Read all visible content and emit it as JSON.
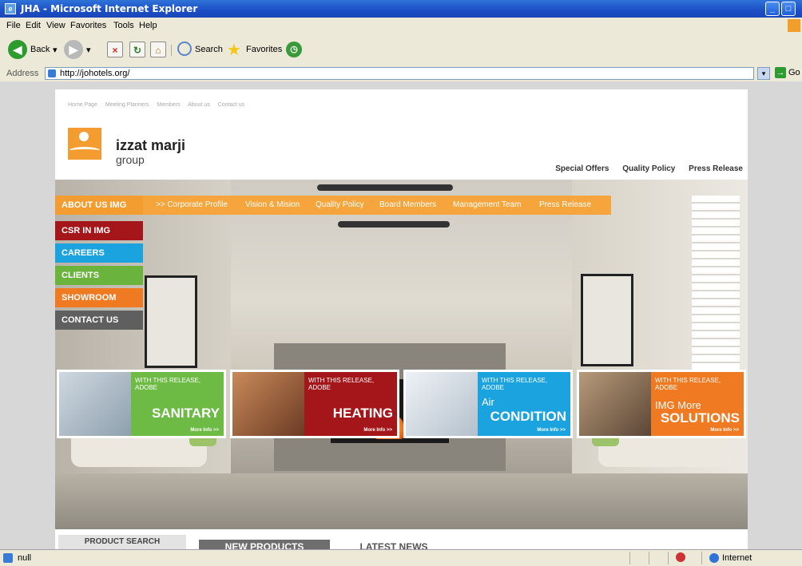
{
  "window": {
    "title": "JHA - Microsoft Internet Explorer"
  },
  "menu": [
    "File",
    "Edit",
    "View",
    "Favorites",
    "Tools",
    "Help"
  ],
  "toolbar": {
    "back_label": "Back",
    "search_label": "Search",
    "favorites_label": "Favorites"
  },
  "address": {
    "label": "Address",
    "url": "http://johotels.org/",
    "go_label": "Go"
  },
  "site": {
    "top_nav": [
      "Home Page",
      "Meeting Planners",
      "Members",
      "About us",
      "Contact us"
    ],
    "logo_name": "izzat marji",
    "logo_sub": "group",
    "right_links": [
      "Special Offers",
      "Quality Policy",
      "Press Release"
    ],
    "about": {
      "title": "ABOUT US IMG",
      "items": [
        ">> Corporate Profile",
        "Vision & Mision",
        "Quality Policy",
        "Board Members",
        "Management Team",
        "Press Release"
      ]
    },
    "side_menu": [
      {
        "label": "CSR  IN IMG",
        "color": "#a5161b"
      },
      {
        "label": "CAREERS",
        "color": "#1ba3e0"
      },
      {
        "label": "CLIENTS",
        "color": "#6ab43e"
      },
      {
        "label": "SHOWROOM",
        "color": "#f07a22"
      },
      {
        "label": "CONTACT US",
        "color": "#5f5f5f"
      }
    ],
    "tiles": [
      {
        "small": "WITH THIS RELEASE, ADOBE",
        "big": "SANITARY",
        "more": "More Info >>",
        "color": "#6dbb45"
      },
      {
        "small": "WITH THIS RELEASE, ADOBE",
        "big": "HEATING",
        "more": "More Info >>",
        "color": "#a5161b"
      },
      {
        "small": "WITH THIS RELEASE, ADOBE",
        "big_line1": "Air",
        "big": "CONDITION",
        "more": "More Info >>",
        "color": "#1ba3e0"
      },
      {
        "small": "WITH THIS RELEASE, ADOBE",
        "big_line1": "IMG More",
        "big": "SOLUTIONS",
        "more": "More Info >>",
        "color": "#f07a22"
      }
    ],
    "tabs": [
      "PRODUCT SEARCH",
      "NEW PRODUCTS",
      "LATEST NEWS"
    ]
  },
  "status": {
    "text": "null",
    "zone": "Internet"
  }
}
